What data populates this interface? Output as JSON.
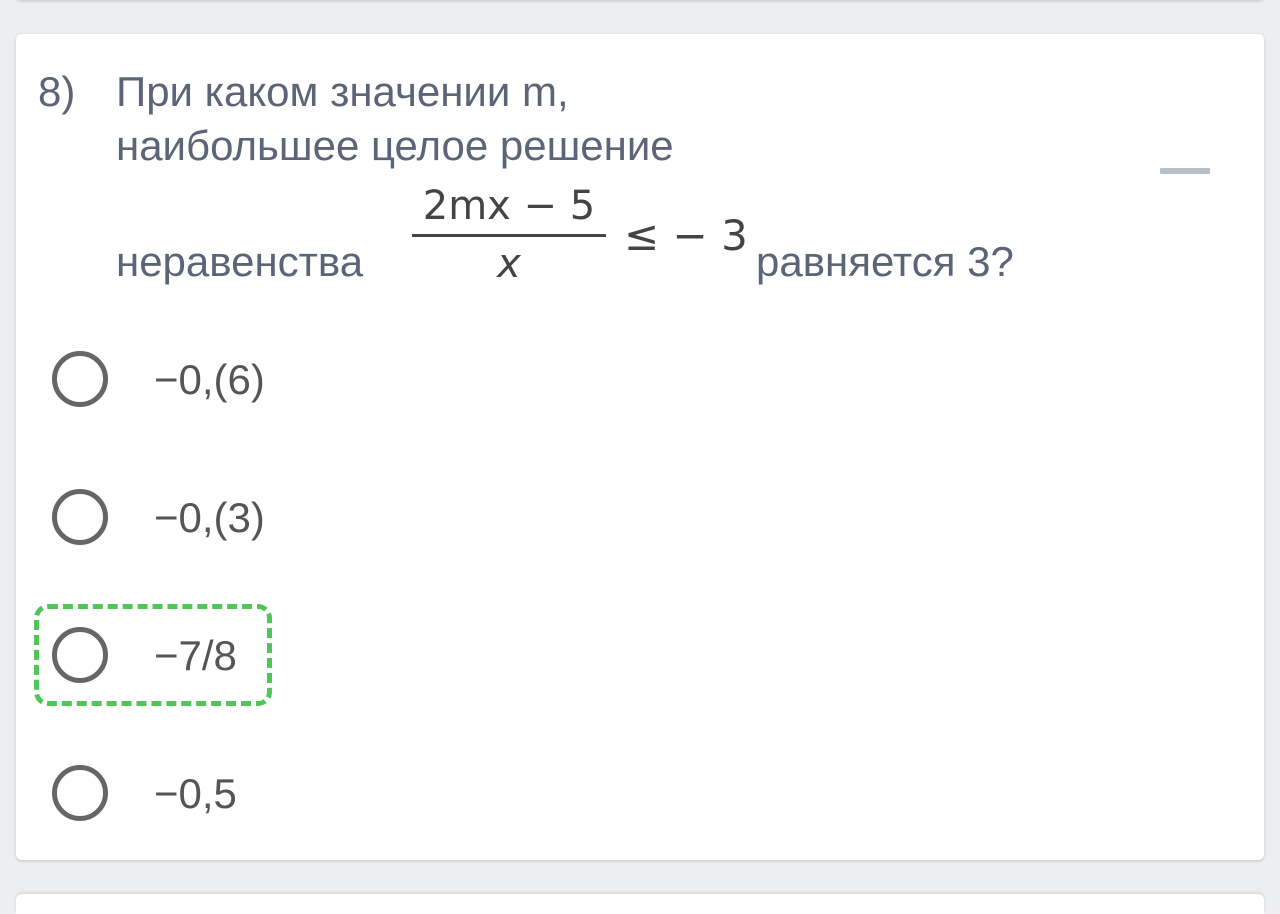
{
  "question": {
    "number": "8)",
    "line1": "При каком значении m,",
    "line2": "наибольшее целое решение",
    "line3": "неравенства",
    "formula": {
      "numerator": "2mx − 5",
      "denominator": "x",
      "relation": "≤ − 3"
    },
    "line4": "равняется 3?"
  },
  "collapse_icon": "minus-icon",
  "options": [
    {
      "label": "−0,(6)",
      "selected": false
    },
    {
      "label": "−0,(3)",
      "selected": false
    },
    {
      "label": "−7/8",
      "selected": false,
      "highlighted": true
    },
    {
      "label": "−0,5",
      "selected": false
    }
  ],
  "colors": {
    "text": "#5b6577",
    "radio_border": "#666666",
    "highlight": "#4fc55a",
    "background": "#edeef0",
    "card": "#ffffff"
  }
}
